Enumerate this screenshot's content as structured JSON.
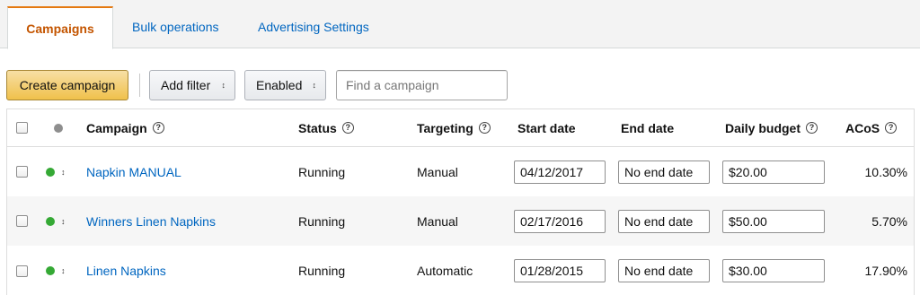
{
  "tabs": [
    {
      "label": "Campaigns",
      "active": true
    },
    {
      "label": "Bulk operations",
      "active": false
    },
    {
      "label": "Advertising Settings",
      "active": false
    }
  ],
  "toolbar": {
    "create_label": "Create campaign",
    "filter_label": "Add filter",
    "enabled_label": "Enabled",
    "search_placeholder": "Find a campaign",
    "updown_icon": "↕"
  },
  "table": {
    "columns": {
      "campaign": "Campaign",
      "status": "Status",
      "targeting": "Targeting",
      "start_date": "Start date",
      "end_date": "End date",
      "daily_budget": "Daily budget",
      "acos": "ACoS"
    },
    "rows": [
      {
        "campaign": "Napkin MANUAL",
        "status": "Running",
        "targeting": "Manual",
        "start_date": "04/12/2017",
        "end_date": "No end date",
        "budget": "$20.00",
        "acos": "10.30%"
      },
      {
        "campaign": "Winners Linen Napkins",
        "status": "Running",
        "targeting": "Manual",
        "start_date": "02/17/2016",
        "end_date": "No end date",
        "budget": "$50.00",
        "acos": "5.70%"
      },
      {
        "campaign": "Linen Napkins",
        "status": "Running",
        "targeting": "Automatic",
        "start_date": "01/28/2015",
        "end_date": "No end date",
        "budget": "$30.00",
        "acos": "17.90%"
      }
    ]
  },
  "colors": {
    "accent_tab": "#c45500",
    "link": "#0066c0",
    "primary_button": "#f0c14b",
    "status_enabled": "#35a935"
  }
}
